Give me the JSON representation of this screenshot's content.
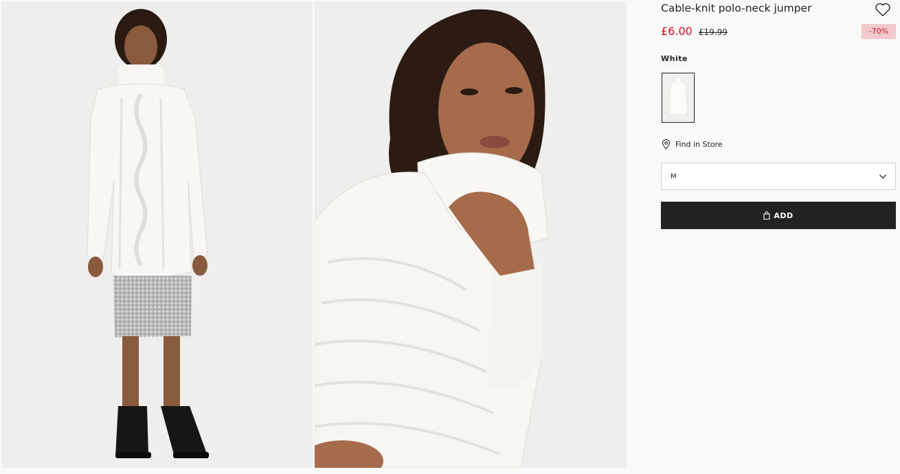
{
  "product": {
    "title": "Cable-knit polo-neck jumper",
    "price_now": "£6.00",
    "price_was": "£19.99",
    "discount_badge": "-70%"
  },
  "colour": {
    "label": "White"
  },
  "store": {
    "label": "Find in Store"
  },
  "size": {
    "selected": "M"
  },
  "cart": {
    "add_label": "ADD"
  },
  "icons": {
    "favourite": "heart-icon",
    "store": "location-pin-icon",
    "dropdown": "chevron-down-icon",
    "bag": "shopping-bag-icon"
  },
  "colors": {
    "sale_price": "#d40824",
    "badge_bg": "#f2c9cd",
    "badge_text": "#c7112c",
    "button_bg": "#222222",
    "page_bg": "#faf9f8"
  }
}
